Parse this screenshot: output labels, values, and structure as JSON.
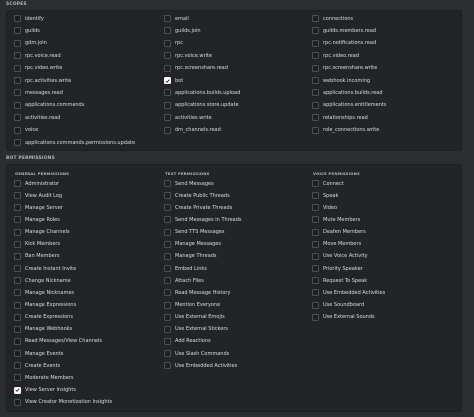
{
  "scopes": {
    "title": "SCOPES",
    "columns": [
      [
        {
          "label": "identify",
          "checked": false
        },
        {
          "label": "guilds",
          "checked": false
        },
        {
          "label": "gdm.join",
          "checked": false
        },
        {
          "label": "rpc.voice.read",
          "checked": false
        },
        {
          "label": "rpc.video.write",
          "checked": false
        },
        {
          "label": "rpc.activities.write",
          "checked": false
        },
        {
          "label": "messages.read",
          "checked": false
        },
        {
          "label": "applications.commands",
          "checked": false
        },
        {
          "label": "activities.read",
          "checked": false
        },
        {
          "label": "voice",
          "checked": false
        },
        {
          "label": "applications.commands.permissions.update",
          "checked": false
        }
      ],
      [
        {
          "label": "email",
          "checked": false
        },
        {
          "label": "guilds.join",
          "checked": false
        },
        {
          "label": "rpc",
          "checked": false
        },
        {
          "label": "rpc.voice.write",
          "checked": false
        },
        {
          "label": "rpc.screenshare.read",
          "checked": false
        },
        {
          "label": "bot",
          "checked": true
        },
        {
          "label": "applications.builds.upload",
          "checked": false
        },
        {
          "label": "applications.store.update",
          "checked": false
        },
        {
          "label": "activities.write",
          "checked": false
        },
        {
          "label": "dm_channels.read",
          "checked": false
        }
      ],
      [
        {
          "label": "connections",
          "checked": false
        },
        {
          "label": "guilds.members.read",
          "checked": false
        },
        {
          "label": "rpc.notifications.read",
          "checked": false
        },
        {
          "label": "rpc.video.read",
          "checked": false
        },
        {
          "label": "rpc.screenshare.write",
          "checked": false
        },
        {
          "label": "webhook.incoming",
          "checked": false
        },
        {
          "label": "applications.builds.read",
          "checked": false
        },
        {
          "label": "applications.entitlements",
          "checked": false
        },
        {
          "label": "relationships.read",
          "checked": false
        },
        {
          "label": "role_connections.write",
          "checked": false
        }
      ]
    ]
  },
  "bot_permissions": {
    "title": "BOT PERMISSIONS",
    "groups": [
      {
        "heading": "GENERAL PERMISSIONS",
        "items": [
          {
            "label": "Administrator",
            "checked": false
          },
          {
            "label": "View Audit Log",
            "checked": false
          },
          {
            "label": "Manage Server",
            "checked": false
          },
          {
            "label": "Manage Roles",
            "checked": false
          },
          {
            "label": "Manage Channels",
            "checked": false
          },
          {
            "label": "Kick Members",
            "checked": false
          },
          {
            "label": "Ban Members",
            "checked": false
          },
          {
            "label": "Create Instant Invite",
            "checked": false
          },
          {
            "label": "Change Nickname",
            "checked": false
          },
          {
            "label": "Manage Nicknames",
            "checked": false
          },
          {
            "label": "Manage Expressions",
            "checked": false
          },
          {
            "label": "Create Expressions",
            "checked": false
          },
          {
            "label": "Manage Webhooks",
            "checked": false
          },
          {
            "label": "Read Messages/View Channels",
            "checked": false
          },
          {
            "label": "Manage Events",
            "checked": false
          },
          {
            "label": "Create Events",
            "checked": false
          },
          {
            "label": "Moderate Members",
            "checked": false
          },
          {
            "label": "View Server Insights",
            "checked": true
          },
          {
            "label": "View Creator Monetization Insights",
            "checked": false
          }
        ]
      },
      {
        "heading": "TEXT PERMISSIONS",
        "items": [
          {
            "label": "Send Messages",
            "checked": false
          },
          {
            "label": "Create Public Threads",
            "checked": false
          },
          {
            "label": "Create Private Threads",
            "checked": false
          },
          {
            "label": "Send Messages in Threads",
            "checked": false
          },
          {
            "label": "Send TTS Messages",
            "checked": false
          },
          {
            "label": "Manage Messages",
            "checked": false
          },
          {
            "label": "Manage Threads",
            "checked": false
          },
          {
            "label": "Embed Links",
            "checked": false
          },
          {
            "label": "Attach Files",
            "checked": false
          },
          {
            "label": "Read Message History",
            "checked": false
          },
          {
            "label": "Mention Everyone",
            "checked": false
          },
          {
            "label": "Use External Emojis",
            "checked": false
          },
          {
            "label": "Use External Stickers",
            "checked": false
          },
          {
            "label": "Add Reactions",
            "checked": false
          },
          {
            "label": "Use Slash Commands",
            "checked": false
          },
          {
            "label": "Use Embedded Activities",
            "checked": false
          }
        ]
      },
      {
        "heading": "VOICE PERMISSIONS",
        "items": [
          {
            "label": "Connect",
            "checked": false
          },
          {
            "label": "Speak",
            "checked": false
          },
          {
            "label": "Video",
            "checked": false
          },
          {
            "label": "Mute Members",
            "checked": false
          },
          {
            "label": "Deafen Members",
            "checked": false
          },
          {
            "label": "Move Members",
            "checked": false
          },
          {
            "label": "Use Voice Activity",
            "checked": false
          },
          {
            "label": "Priority Speaker",
            "checked": false
          },
          {
            "label": "Request To Speak",
            "checked": false
          },
          {
            "label": "Use Embedded Activities",
            "checked": false
          },
          {
            "label": "Use Soundboard",
            "checked": false
          },
          {
            "label": "Use External Sounds",
            "checked": false
          }
        ]
      }
    ]
  }
}
